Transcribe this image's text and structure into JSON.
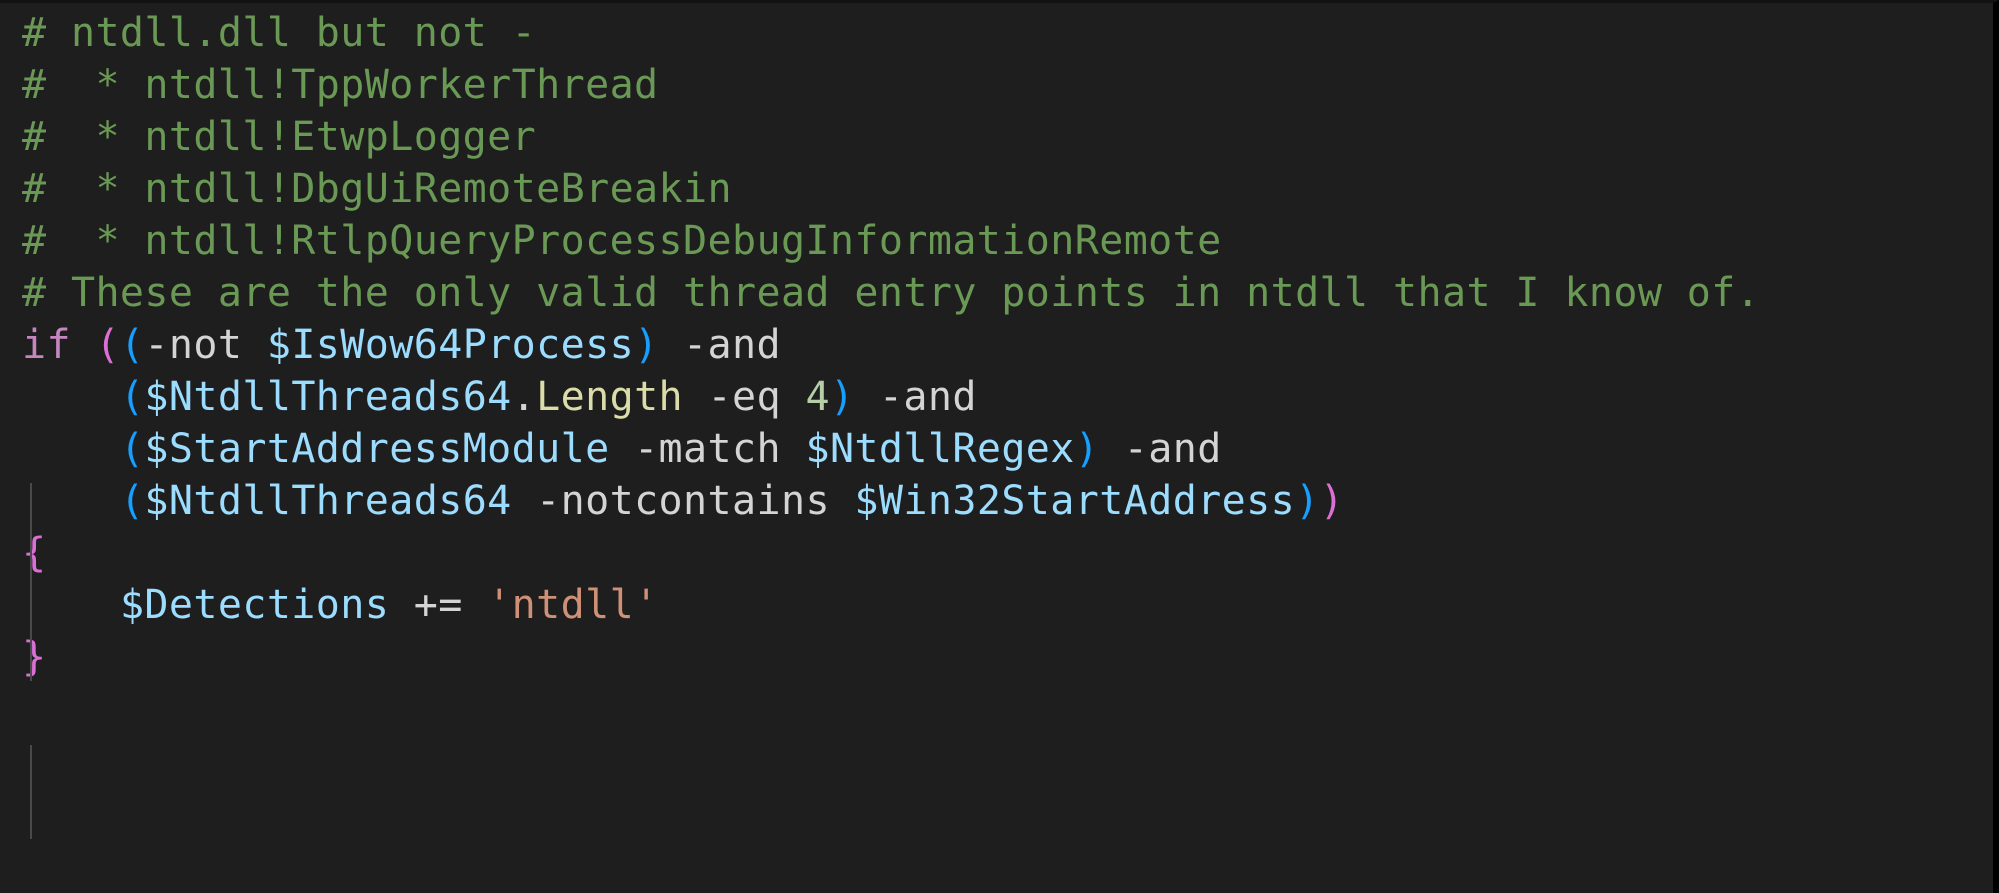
{
  "editor": {
    "language": "PowerShell",
    "background_color": "#1e1e1e",
    "indent_guide_color": "#494949",
    "theme_colors": {
      "comment": "#6a9955",
      "keyword": "#c586c0",
      "bracket_level_1": "#da70d6",
      "bracket_level_2": "#179fff",
      "operator": "#d4d4d4",
      "variable": "#9cdcfe",
      "property": "#dcdcaa",
      "number": "#b5cea8",
      "string": "#ce9178"
    }
  },
  "code": {
    "lines": [
      {
        "id": "line-1",
        "text": "# ntdll.dll but not -",
        "tokens": [
          {
            "t": "# ntdll.dll but not -",
            "c": "c-comment"
          }
        ]
      },
      {
        "id": "line-2",
        "text": "#  * ntdll!TppWorkerThread",
        "tokens": [
          {
            "t": "#  * ntdll!TppWorkerThread",
            "c": "c-comment"
          }
        ]
      },
      {
        "id": "line-3",
        "text": "#  * ntdll!EtwpLogger",
        "tokens": [
          {
            "t": "#  * ntdll!EtwpLogger",
            "c": "c-comment"
          }
        ]
      },
      {
        "id": "line-4",
        "text": "#  * ntdll!DbgUiRemoteBreakin",
        "tokens": [
          {
            "t": "#  * ntdll!DbgUiRemoteBreakin",
            "c": "c-comment"
          }
        ]
      },
      {
        "id": "line-5",
        "text": "#  * ntdll!RtlpQueryProcessDebugInformationRemote",
        "tokens": [
          {
            "t": "#  * ntdll!RtlpQueryProcessDebugInformationRemote",
            "c": "c-comment"
          }
        ]
      },
      {
        "id": "line-6",
        "text": "# These are the only valid thread entry points in ntdll that I know of.",
        "tokens": [
          {
            "t": "# These are the only valid thread entry points in ntdll that I know of.",
            "c": "c-comment"
          }
        ]
      },
      {
        "id": "line-7",
        "text": "if ((-not $IsWow64Process) -and",
        "tokens": [
          {
            "t": "if",
            "c": "c-keyword"
          },
          {
            "t": " ",
            "c": "c-plain"
          },
          {
            "t": "(",
            "c": "c-paren1"
          },
          {
            "t": "(",
            "c": "c-paren2"
          },
          {
            "t": "-not",
            "c": "c-operator"
          },
          {
            "t": " ",
            "c": "c-plain"
          },
          {
            "t": "$IsWow64Process",
            "c": "c-variable"
          },
          {
            "t": ")",
            "c": "c-paren2"
          },
          {
            "t": " ",
            "c": "c-plain"
          },
          {
            "t": "-and",
            "c": "c-operator"
          }
        ]
      },
      {
        "id": "line-8",
        "text": "    ($NtdllThreads64.Length -eq 4) -and",
        "tokens": [
          {
            "t": "    ",
            "c": "c-plain"
          },
          {
            "t": "(",
            "c": "c-paren2"
          },
          {
            "t": "$NtdllThreads64",
            "c": "c-variable"
          },
          {
            "t": ".",
            "c": "c-plain"
          },
          {
            "t": "Length",
            "c": "c-property"
          },
          {
            "t": " ",
            "c": "c-plain"
          },
          {
            "t": "-eq",
            "c": "c-operator"
          },
          {
            "t": " ",
            "c": "c-plain"
          },
          {
            "t": "4",
            "c": "c-number"
          },
          {
            "t": ")",
            "c": "c-paren2"
          },
          {
            "t": " ",
            "c": "c-plain"
          },
          {
            "t": "-and",
            "c": "c-operator"
          }
        ]
      },
      {
        "id": "line-9",
        "text": "    ($StartAddressModule -match $NtdllRegex) -and",
        "tokens": [
          {
            "t": "    ",
            "c": "c-plain"
          },
          {
            "t": "(",
            "c": "c-paren2"
          },
          {
            "t": "$StartAddressModule",
            "c": "c-variable"
          },
          {
            "t": " ",
            "c": "c-plain"
          },
          {
            "t": "-match",
            "c": "c-operator"
          },
          {
            "t": " ",
            "c": "c-plain"
          },
          {
            "t": "$NtdllRegex",
            "c": "c-variable"
          },
          {
            "t": ")",
            "c": "c-paren2"
          },
          {
            "t": " ",
            "c": "c-plain"
          },
          {
            "t": "-and",
            "c": "c-operator"
          }
        ]
      },
      {
        "id": "line-10",
        "text": "    ($NtdllThreads64 -notcontains $Win32StartAddress))",
        "tokens": [
          {
            "t": "    ",
            "c": "c-plain"
          },
          {
            "t": "(",
            "c": "c-paren2"
          },
          {
            "t": "$NtdllThreads64",
            "c": "c-variable"
          },
          {
            "t": " ",
            "c": "c-plain"
          },
          {
            "t": "-notcontains",
            "c": "c-operator"
          },
          {
            "t": " ",
            "c": "c-plain"
          },
          {
            "t": "$Win32StartAddress",
            "c": "c-variable"
          },
          {
            "t": ")",
            "c": "c-paren2"
          },
          {
            "t": ")",
            "c": "c-paren1"
          }
        ]
      },
      {
        "id": "line-11",
        "text": "{",
        "tokens": [
          {
            "t": "{",
            "c": "c-brace"
          }
        ]
      },
      {
        "id": "line-12",
        "text": "    $Detections += 'ntdll'",
        "tokens": [
          {
            "t": "    ",
            "c": "c-plain"
          },
          {
            "t": "$Detections",
            "c": "c-variable"
          },
          {
            "t": " ",
            "c": "c-plain"
          },
          {
            "t": "+=",
            "c": "c-operator"
          },
          {
            "t": " ",
            "c": "c-plain"
          },
          {
            "t": "'ntdll'",
            "c": "c-string"
          }
        ]
      },
      {
        "id": "line-13",
        "text": "}",
        "tokens": [
          {
            "t": "}",
            "c": "c-brace"
          }
        ]
      }
    ]
  }
}
